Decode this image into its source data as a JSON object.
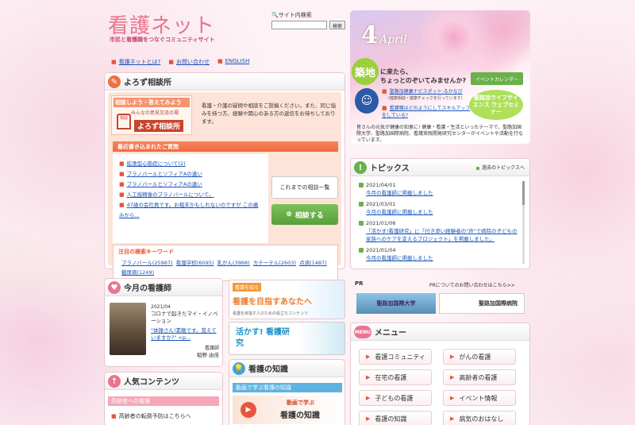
{
  "site": {
    "logo_text": "看護ネット",
    "tagline": "市民と看護職をつなぐコミュニティサイト",
    "links": [
      "看護ネットとは?",
      "お問い合わせ",
      "ENGLISH"
    ]
  },
  "search": {
    "label": "サイト内検索",
    "button": "検索"
  },
  "banner": {
    "date_number": "4",
    "date_month": "April",
    "badge": "築地",
    "text1": "に来たら、",
    "text2": "ちょっとのぞいてみませんか?",
    "calendar_button": "イベントカレンダー",
    "links": [
      {
        "text": "聖路加健康ナビスポット:るかなび",
        "sub": "(健康相談・健康チェックを行っています)"
      },
      {
        "text": "看護職はどのようにしてスキルアップをしている?"
      }
    ],
    "caption": "健康・看護・生活といったテーマで、聖路加国際大学、聖路加国際病院、看護実践開発研究センターがイベントや活動を行なっています。",
    "caption_head": "皆さんの元気が健康の知恵に!",
    "oval_label": "聖路加ライフサイエンス ウェブセミナー"
  },
  "consult": {
    "title": "よろず相談所",
    "img_title": "相談しよう・答えてみよう",
    "img_sub": "みんなの意見交流の場",
    "img_sign": "よろず相談所",
    "desc": "看護・介護の疑問や相談をご投稿ください。また、同じ悩みを持つ方、経験や関心のある方の返信をお待ちしております。",
    "recent_header": "最近書き込まれたご質問",
    "questions": [
      "拡張型心筋症について(2)",
      "プラノバールとソフィアAの違い",
      "プラノバールとソフィアAの違い",
      "人工授精後のプラノバールについて。",
      "47歳の会社員です。お粗末かもしれないのですが この痛 みから..."
    ],
    "list_button": "これまでの相談一覧",
    "ask_button": "相談する",
    "keywords_header": "注目の検索キーワード",
    "keywords": [
      "プラノバール(25987)",
      "看護学校(6095)",
      "乳がん(3968)",
      "カテーテル(2603)",
      "点滴(1487)",
      "糖尿病(1249)"
    ]
  },
  "nurse": {
    "title": "今月の看護師",
    "date": "2021/04",
    "headline": "コロナで起きたマイ・イノベーション",
    "quote": "\"体操さん!素敵です。覚えていますか?\" <p...",
    "role": "看護師",
    "name": "稲野 由佳"
  },
  "popular": {
    "title": "人気コンテンツ",
    "sub_header": "高齢者への看護",
    "item": "高齢者の転倒予防はこちらへ"
  },
  "promo": {
    "nursing_badge": "看護を知る",
    "nursing_main": "看護を目指すあなたへ",
    "nursing_sub": "看護を目指す人のための役立ちコンテンツ",
    "katsu_main": "活かす! 看護研究",
    "knowledge_title": "看護の知識",
    "knowledge_bar": "動画で学ぶ看護の知識",
    "knowledge_img1": "動画で学ぶ",
    "knowledge_img2": "看護の知識"
  },
  "topics": {
    "title": "トピックス",
    "past_link": "過去のトピックスへ",
    "items": [
      {
        "date": "2021/04/01",
        "text": "今月の看護師に掲載しました"
      },
      {
        "date": "2021/03/01",
        "text": "今月の看護師に掲載しました"
      },
      {
        "date": "2021/01/06",
        "text": "「活かす!看護研究」に「付き添い経験者の\"声\"で病院の子どもの家族へのケアを変えるプロジェクト」を掲載しました。"
      },
      {
        "date": "2021/01/04",
        "text": "今月の看護師に掲載しました"
      }
    ]
  },
  "pr": {
    "label": "PR",
    "inquiry": "PRについてのお問い合わせはこちら>>",
    "ads": [
      "聖路加国際大学",
      "聖路加国際病院"
    ]
  },
  "menu": {
    "title": "メニュー",
    "items": [
      "看護コミュニティ",
      "がんの看護",
      "在宅の看護",
      "高齢者の看護",
      "子どもの看護",
      "イベント情報",
      "看護の知識",
      "病気のおはなし"
    ]
  },
  "colors": {
    "pink": "#e8758f",
    "green": "#6ab04c",
    "orange": "#f0703f",
    "blue": "#1a55b8"
  }
}
